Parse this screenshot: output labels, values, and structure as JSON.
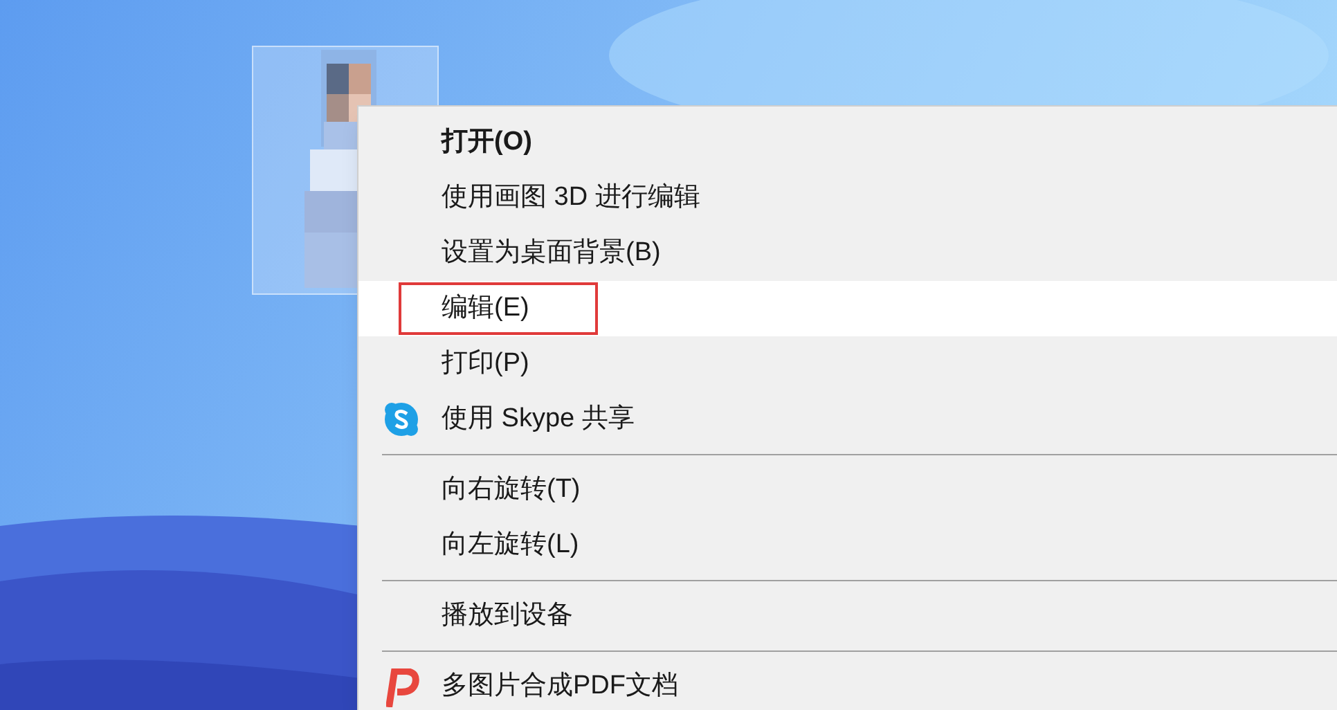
{
  "desktop": {
    "icons": [
      {
        "kind": "picture",
        "selected": true
      }
    ]
  },
  "context_menu": {
    "items": [
      {
        "kind": "item",
        "label": "打开(O)",
        "bold": true,
        "selected": false
      },
      {
        "kind": "item",
        "label": "使用画图 3D 进行编辑",
        "bold": false,
        "selected": false
      },
      {
        "kind": "item",
        "label": "设置为桌面背景(B)",
        "bold": false,
        "selected": false
      },
      {
        "kind": "item",
        "label": "编辑(E)",
        "bold": false,
        "selected": true,
        "outlined": true
      },
      {
        "kind": "item",
        "label": "打印(P)",
        "bold": false,
        "selected": false
      },
      {
        "kind": "s_bubble_item",
        "label": "使用 Skype 共享",
        "bold": false,
        "selected": false
      },
      {
        "kind": "separator"
      },
      {
        "kind": "item",
        "label": "向右旋转(T)",
        "bold": false,
        "selected": false
      },
      {
        "kind": "item",
        "label": "向左旋转(L)",
        "bold": false,
        "selected": false
      },
      {
        "kind": "separator"
      },
      {
        "kind": "item",
        "label": "播放到设备",
        "bold": false,
        "selected": false
      },
      {
        "kind": "separator"
      },
      {
        "kind": "p_letter_item",
        "label": "多图片合成PDF文档",
        "bold": false,
        "selected": false
      }
    ]
  }
}
